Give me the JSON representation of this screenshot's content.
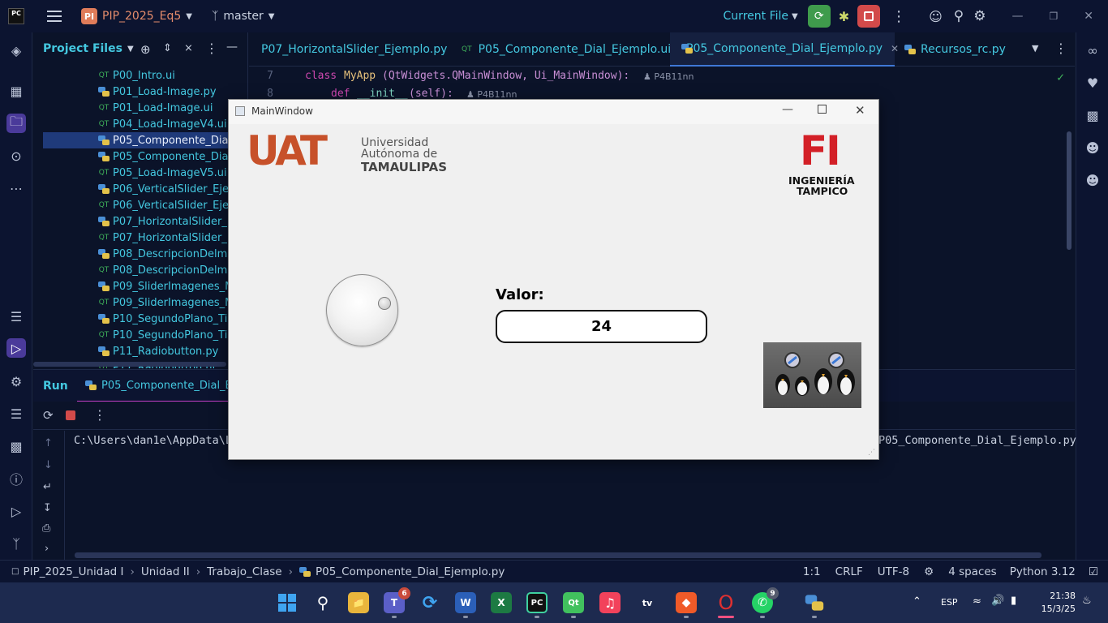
{
  "topbar": {
    "logo": "PC",
    "menu_icon": "hamburger-menu-icon",
    "project_badge": "PI",
    "project_name": "PIP_2025_Eq5",
    "branch": "master",
    "run_config": "Current File",
    "colors": {
      "run": "#3f9b4c",
      "stop": "#d24a4a",
      "badge": "#e07c5a"
    }
  },
  "project_panel": {
    "title": "Project Files",
    "files": [
      {
        "name": "P00_Intro.ui",
        "type": "ui"
      },
      {
        "name": "P01_Load-Image.py",
        "type": "py"
      },
      {
        "name": "P01_Load-Image.ui",
        "type": "ui"
      },
      {
        "name": "P04_Load-ImageV4.ui",
        "type": "ui"
      },
      {
        "name": "P05_Componente_Dial_",
        "type": "py",
        "selected": true
      },
      {
        "name": "P05_Componente_Dial_",
        "type": "py"
      },
      {
        "name": "P05_Load-ImageV5.ui",
        "type": "ui"
      },
      {
        "name": "P06_VerticalSlider_Ejem",
        "type": "py"
      },
      {
        "name": "P06_VerticalSlider_Ejem",
        "type": "ui"
      },
      {
        "name": "P07_HorizontalSlider_E",
        "type": "py"
      },
      {
        "name": "P07_HorizontalSlider_E",
        "type": "ui"
      },
      {
        "name": "P08_DescripcionDelmac",
        "type": "py"
      },
      {
        "name": "P08_DescripcionDelmac",
        "type": "ui"
      },
      {
        "name": "P09_SliderImagenes_M",
        "type": "py"
      },
      {
        "name": "P09_SliderImagenes_M",
        "type": "ui"
      },
      {
        "name": "P10_SegundoPlano_Tim",
        "type": "py"
      },
      {
        "name": "P10_SegundoPlano_Tim",
        "type": "ui"
      },
      {
        "name": "P11_Radiobutton.py",
        "type": "py"
      },
      {
        "name": "P11_Radiobutton.ui",
        "type": "ui"
      }
    ]
  },
  "editor": {
    "tabs": [
      {
        "label": "P07_HorizontalSlider_Ejemplo.py",
        "type": "py"
      },
      {
        "label": "P05_Componente_Dial_Ejemplo.ui",
        "type": "ui"
      },
      {
        "label": "P05_Componente_Dial_Ejemplo.py",
        "type": "py",
        "active": true
      },
      {
        "label": "Recursos_rc.py",
        "type": "py"
      }
    ],
    "lines": [
      {
        "num": "7",
        "kw": "class",
        "name": "MyApp",
        "args": "(QtWidgets.QMainWindow, Ui_MainWindow):",
        "author": "P4B11nn"
      },
      {
        "num": "8",
        "kw": "def",
        "name": "__init__",
        "args": "(self):",
        "author": "P4B11nn"
      }
    ]
  },
  "run_panel": {
    "tab_label": "Run",
    "config_label": "P05_Componente_Dial_Ej",
    "console_left": "C:\\Users\\dan1e\\AppData\\L",
    "console_right": "P05_Componente_Dial_Ejemplo.py"
  },
  "statusbar": {
    "breadcrumbs": [
      "PIP_2025_Unidad I",
      "Unidad II",
      "Trabajo_Clase",
      "P05_Componente_Dial_Ejemplo.py"
    ],
    "position": "1:1",
    "line_sep": "CRLF",
    "encoding": "UTF-8",
    "indent": "4 spaces",
    "interpreter": "Python 3.12"
  },
  "qt_window": {
    "title": "MainWindow",
    "uat_logo": {
      "letters": "UAT",
      "line1": "Universidad",
      "line2": "Autónoma de",
      "line3": "TAMAULIPAS"
    },
    "fi_logo": {
      "letters": "FI",
      "line1": "INGENIERÍA",
      "line2": "TAMPICO"
    },
    "valor_label": "Valor:",
    "valor_value": "24",
    "dial_level": 24
  },
  "taskbar": {
    "lang": "ESP",
    "time": "21:38",
    "date": "15/3/25",
    "teams_badge": "6",
    "whatsapp_badge": "9"
  }
}
